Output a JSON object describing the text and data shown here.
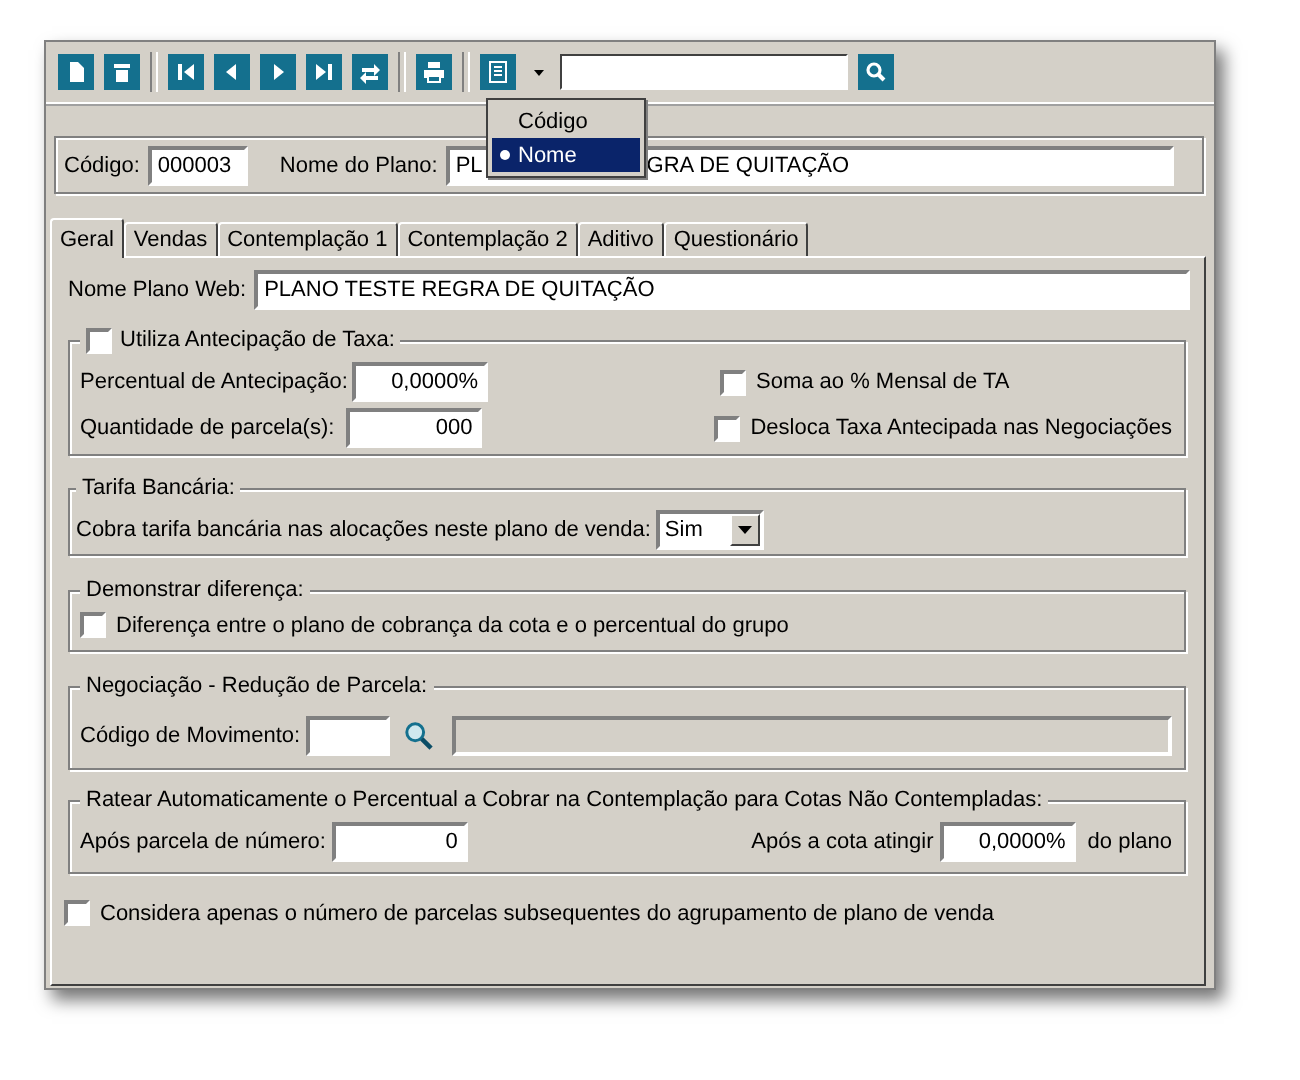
{
  "sort_menu": {
    "items": [
      {
        "label": "Código",
        "selected": false
      },
      {
        "label": "Nome",
        "selected": true
      }
    ]
  },
  "header": {
    "code": {
      "label": "Código:",
      "value": "000003"
    },
    "plan_name": {
      "label": "Nome do Plano:",
      "value_parts": [
        "PL",
        "GRA DE QUITAÇÃO"
      ]
    }
  },
  "tabs": [
    {
      "label": "Geral",
      "selected": true
    },
    {
      "label": "Vendas",
      "selected": false
    },
    {
      "label": "Contemplação 1",
      "selected": false
    },
    {
      "label": "Contemplação 2",
      "selected": false
    },
    {
      "label": "Aditivo",
      "selected": false
    },
    {
      "label": "Questionário",
      "selected": false
    }
  ],
  "web_name": {
    "label": "Nome Plano Web:",
    "value": "PLANO TESTE REGRA DE QUITAÇÃO"
  },
  "anticipation": {
    "label": "Utiliza Antecipação de Taxa:",
    "checked": false,
    "fields": [
      {
        "label": "Percentual de Antecipação:",
        "value": "0,0000%"
      },
      {
        "label": "Quantidade de parcela(s):",
        "value": "000"
      }
    ],
    "options": [
      {
        "label": "Soma ao % Mensal de TA",
        "checked": false
      },
      {
        "label": "Desloca Taxa Antecipada nas Negociações",
        "checked": false
      }
    ]
  },
  "bank_fee": {
    "title": "Tarifa Bancária:",
    "label": "Cobra tarifa bancária nas alocações neste plano de venda:",
    "value": "Sim"
  },
  "difference": {
    "title": "Demonstrar diferença:",
    "option": {
      "label": "Diferença entre o plano de cobrança da cota e o percentual do grupo",
      "checked": false
    }
  },
  "negotiation": {
    "title": "Negociação - Redução de Parcela:",
    "label": "Código de Movimento:"
  },
  "apportion": {
    "title": "Ratear Automaticamente o Percentual a Cobrar na Contemplação para Cotas Não Contempladas:",
    "installment": {
      "label": "Após parcela de número:",
      "value": "0"
    },
    "quota": {
      "label": "Após a cota atingir",
      "value": "0,0000%",
      "suffix": "do plano"
    }
  },
  "consider": {
    "label": "Considera apenas o número de parcelas subsequentes do agrupamento de plano de venda",
    "checked": false
  }
}
